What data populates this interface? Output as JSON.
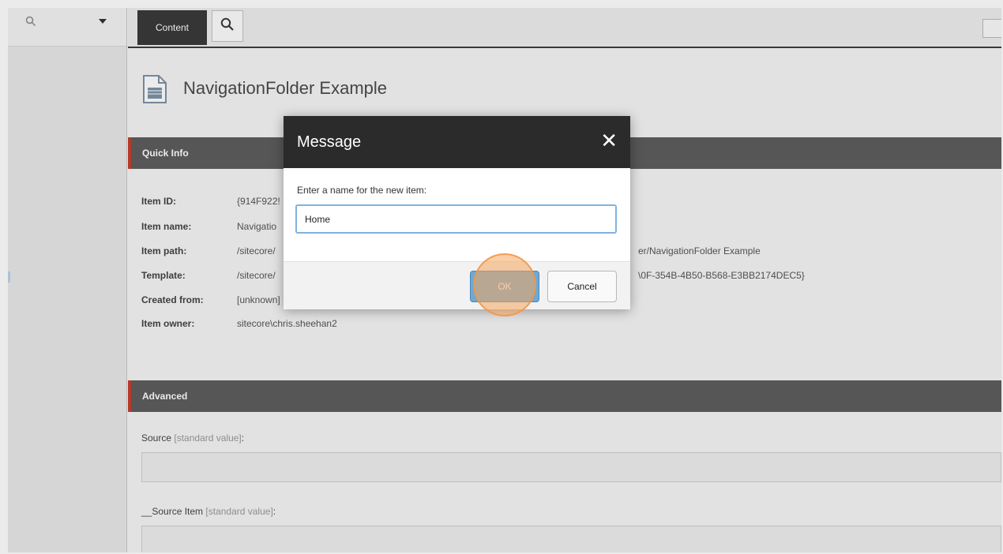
{
  "tabs": {
    "content_label": "Content"
  },
  "item": {
    "title": "NavigationFolder Example"
  },
  "quick_info": {
    "header": "Quick Info",
    "rows": [
      {
        "label": "Item ID:",
        "value": "{914F922!"
      },
      {
        "label": "Item name:",
        "value": "Navigatio"
      },
      {
        "label": "Item path:",
        "value": "/sitecore/",
        "value_tail": "er/NavigationFolder Example"
      },
      {
        "label": "Template:",
        "value": "/sitecore/",
        "value_tail": "\\0F-354B-4B50-B568-E3BB2174DEC5}"
      },
      {
        "label": "Created from:",
        "value": "[unknown]"
      },
      {
        "label": "Item owner:",
        "value": "sitecore\\chris.sheehan2"
      }
    ]
  },
  "advanced": {
    "header": "Advanced",
    "fields": [
      {
        "label": "Source",
        "note": "[standard value]",
        "suffix": ":",
        "value": ""
      },
      {
        "label": "__Source Item",
        "note": "[standard value]",
        "suffix": ":",
        "value": ""
      }
    ]
  },
  "dialog": {
    "title": "Message",
    "close_glyph": "✕",
    "prompt": "Enter a name for the new item:",
    "input_value": "Home",
    "ok_label": "OK",
    "cancel_label": "Cancel"
  },
  "colors": {
    "section_header": "#5e5e5e",
    "section_accent": "#c4412e",
    "dialog_header": "#2b2b2b",
    "ok_button": "#6ea9d4",
    "click_highlight": "#f6a65c"
  },
  "icons": [
    "search-icon",
    "caret-down-icon",
    "search-tab-icon",
    "document-icon",
    "close-icon"
  ]
}
